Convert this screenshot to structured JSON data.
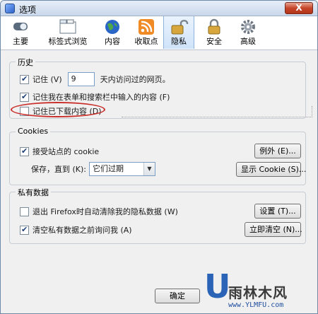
{
  "window": {
    "title": "选项",
    "close_label": "X"
  },
  "toolbar": {
    "tabs": [
      {
        "label": "主要",
        "icon": "switch-icon"
      },
      {
        "label": "标签式浏览",
        "icon": "tabs-icon"
      },
      {
        "label": "内容",
        "icon": "globe-icon"
      },
      {
        "label": "收取点",
        "icon": "feed-icon"
      },
      {
        "label": "隐私",
        "icon": "lock-icon",
        "active": true
      },
      {
        "label": "安全",
        "icon": "padlock-icon"
      },
      {
        "label": "高级",
        "icon": "gear-icon"
      }
    ]
  },
  "history": {
    "title": "历史",
    "remember_prefix": "记住 (V)",
    "remember_days": "9",
    "remember_suffix": "天内访问过的网页。",
    "remember_forms": "记住我在表单和搜索栏中输入的内容 (F)",
    "remember_downloads": "记住已下载内容 (D)"
  },
  "cookies": {
    "title": "Cookies",
    "accept": "接受站点的 cookie",
    "exceptions_button": "例外 (E)...",
    "keep_until_label": "保存，直到 (K):",
    "keep_until_value": "它们过期",
    "show_cookies_button": "显示 Cookie (S)..."
  },
  "private_data": {
    "title": "私有数据",
    "clear_on_exit": "退出 Firefox时自动清除我的隐私数据 (W)",
    "settings_button": "设置 (T)...",
    "ask_before_clear": "清空私有数据之前询问我 (A)",
    "clear_now_button": "立即清空 (N)..."
  },
  "footer": {
    "ok_button": "确定"
  },
  "watermark": {
    "letter": "U",
    "brand": "雨林木风",
    "url": "www.YLMFU.com"
  },
  "colors": {
    "highlight_ellipse": "#c9302c",
    "accent": "#2b63b6"
  }
}
